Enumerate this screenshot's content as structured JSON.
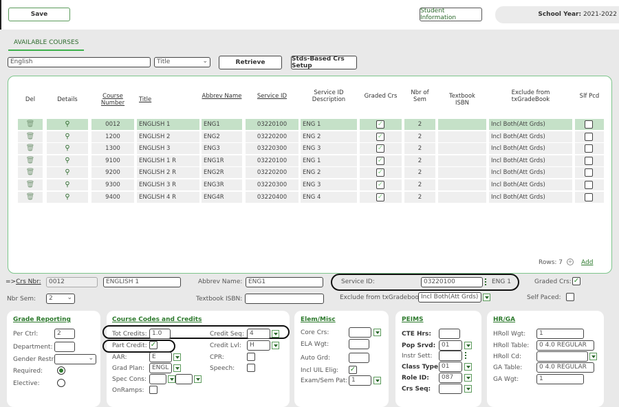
{
  "header": {
    "save_label": "Save",
    "student_info_label": "Student Information",
    "school_year_label": "School Year:",
    "school_year_value": "2021-2022"
  },
  "tab": {
    "label": "AVAILABLE COURSES"
  },
  "search": {
    "value": "English",
    "field_select": "Title",
    "retrieve_label": "Retrieve",
    "stds_label": "Stds-Based Crs Setup"
  },
  "table": {
    "headers": [
      "Del",
      "Details",
      "Course Number",
      "Title",
      "Abbrev Name",
      "Service ID",
      "Service ID Description",
      "Graded Crs",
      "Nbr of Sem",
      "Textbook ISBN",
      "Exclude from txGradeBook",
      "Slf Pcd"
    ],
    "rows": [
      {
        "course_number": "0012",
        "title": "ENGLISH 1",
        "abbrev": "ENG1",
        "service_id": "03220100",
        "desc": "ENG 1",
        "graded": true,
        "nbr_sem": "2",
        "isbn": "",
        "exclude": "Incl Both(Att Grds)",
        "slf_pcd": false,
        "selected": true
      },
      {
        "course_number": "1200",
        "title": "ENGLISH 2",
        "abbrev": "ENG2",
        "service_id": "03220200",
        "desc": "ENG 2",
        "graded": true,
        "nbr_sem": "2",
        "isbn": "",
        "exclude": "Incl Both(Att Grds)",
        "slf_pcd": false
      },
      {
        "course_number": "1300",
        "title": "ENGLISH 3",
        "abbrev": "ENG3",
        "service_id": "03220300",
        "desc": "ENG 3",
        "graded": true,
        "nbr_sem": "2",
        "isbn": "",
        "exclude": "Incl Both(Att Grds)",
        "slf_pcd": false
      },
      {
        "course_number": "9100",
        "title": "ENGLISH 1 R",
        "abbrev": "ENG1R",
        "service_id": "03220100",
        "desc": "ENG 1",
        "graded": true,
        "nbr_sem": "2",
        "isbn": "",
        "exclude": "Incl Both(Att Grds)",
        "slf_pcd": false
      },
      {
        "course_number": "9200",
        "title": "ENGLISH 2 R",
        "abbrev": "ENG2R",
        "service_id": "03220200",
        "desc": "ENG 2",
        "graded": true,
        "nbr_sem": "2",
        "isbn": "",
        "exclude": "Incl Both(Att Grds)",
        "slf_pcd": false
      },
      {
        "course_number": "9300",
        "title": "ENGLISH 3 R",
        "abbrev": "ENG3R",
        "service_id": "03220300",
        "desc": "ENG 3",
        "graded": true,
        "nbr_sem": "2",
        "isbn": "",
        "exclude": "Incl Both(Att Grds)",
        "slf_pcd": false
      },
      {
        "course_number": "9400",
        "title": "ENGLISH 4 R",
        "abbrev": "ENG4R",
        "service_id": "03220400",
        "desc": "ENG 4",
        "graded": true,
        "nbr_sem": "2",
        "isbn": "",
        "exclude": "Incl Both(Att Grds)",
        "slf_pcd": false
      }
    ],
    "rows_label": "Rows: 7",
    "add_label": "Add"
  },
  "detail": {
    "crs_nbr_prefix": "=>",
    "crs_nbr_label": "Crs Nbr:",
    "crs_nbr": "0012",
    "title": "ENGLISH 1",
    "abbrev_label": "Abbrev Name:",
    "abbrev": "ENG1",
    "service_id_label": "Service ID:",
    "service_id": "03220100",
    "service_desc": "ENG 1",
    "graded_label": "Graded Crs:",
    "nbr_sem_label": "Nbr Sem:",
    "nbr_sem": "2",
    "isbn_label": "Textbook ISBN:",
    "isbn": "",
    "exclude_label": "Exclude from txGradebook:",
    "exclude": "Incl Both(Att Grds)",
    "self_paced_label": "Self Paced:"
  },
  "grade_reporting": {
    "title": "Grade Reporting",
    "per_ctrl_label": "Per Ctrl:",
    "per_ctrl": "2",
    "department_label": "Department:",
    "gender_label": "Gender Restr:",
    "required_label": "Required:",
    "elective_label": "Elective:"
  },
  "course_codes": {
    "title": "Course Codes and Credits",
    "tot_credits_label": "Tot Credits:",
    "tot_credits": "1.0",
    "credit_seq_label": "Credit Seq:",
    "credit_seq": "4",
    "part_credit_label": "Part Credit:",
    "credit_lvl_label": "Credit Lvl:",
    "credit_lvl": "H",
    "aar_label": "AAR:",
    "aar": "E",
    "cpr_label": "CPR:",
    "grad_plan_label": "Grad Plan:",
    "grad_plan": "ENGL",
    "speech_label": "Speech:",
    "spec_cons_label": "Spec Cons:",
    "onramps_label": "OnRamps:"
  },
  "elem_misc": {
    "title": "Elem/Misc",
    "core_label": "Core Crs:",
    "ela_label": "ELA Wgt:",
    "auto_label": "Auto Grd:",
    "uil_label": "Incl UIL Elig:",
    "exam_label": "Exam/Sem Pat:",
    "exam": "1"
  },
  "peims": {
    "title": "PEIMS",
    "cte_label": "CTE Hrs:",
    "pop_label": "Pop Srvd:",
    "pop": "01",
    "instr_label": "Instr Sett:",
    "class_label": "Class Type:",
    "class": "01",
    "role_label": "Role ID:",
    "role": "087",
    "crs_seq_label": "Crs Seq:"
  },
  "hrga": {
    "title": "HR/GA",
    "hroll_wgt_label": "HRoll Wgt:",
    "hroll_wgt": "1",
    "hroll_table_label": "HRoll Table:",
    "hroll_table": "0 4.0 REGULAR",
    "hroll_cd_label": "HRoll Cd:",
    "ga_table_label": "GA Table:",
    "ga_table": "0 4.0 REGULAR",
    "ga_wgt_label": "GA Wgt:",
    "ga_wgt": "1"
  },
  "colors": {
    "accent": "#2d7a2d",
    "selected_row": "#c5e1c8",
    "row": "#efefef"
  }
}
